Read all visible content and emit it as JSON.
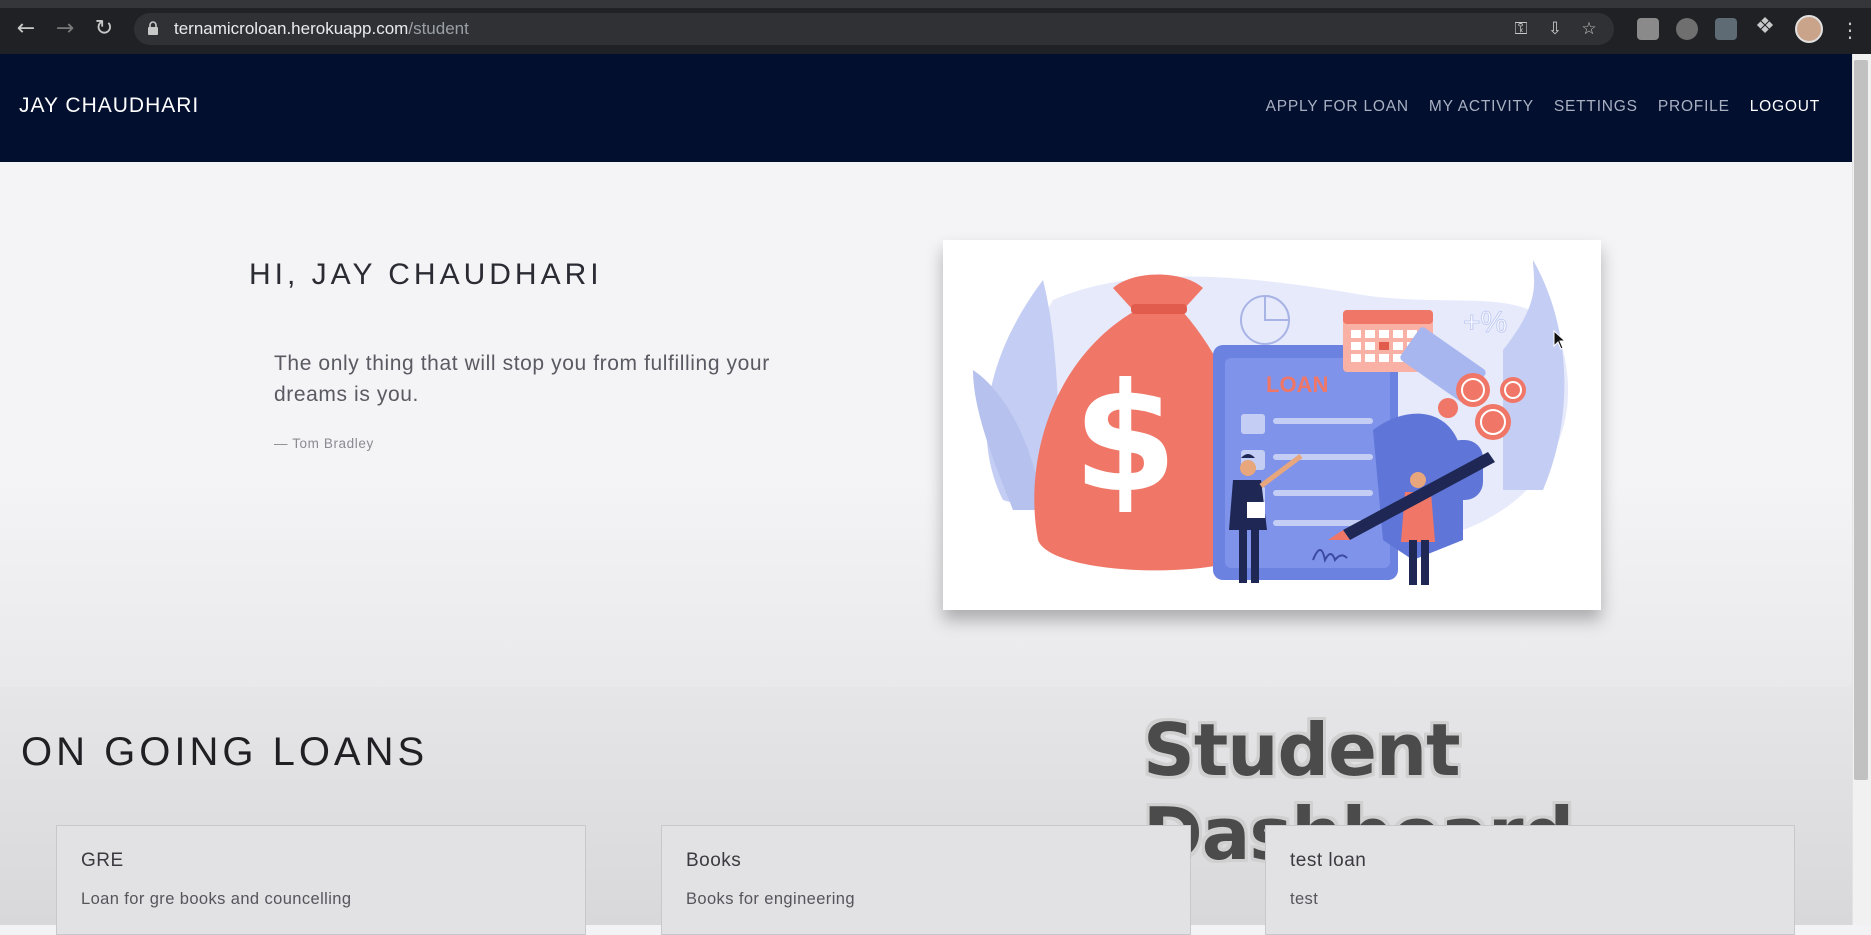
{
  "browser": {
    "url_host": "ternamicroloan.herokuapp.com",
    "url_path": "/student"
  },
  "navbar": {
    "brand": "JAY CHAUDHARI",
    "links": [
      "APPLY FOR LOAN",
      "MY ACTIVITY",
      "SETTINGS",
      "PROFILE",
      "LOGOUT"
    ]
  },
  "hero": {
    "greeting": "HI, JAY CHAUDHARI",
    "quote": "The only thing that will stop you from fulfilling your dreams is you.",
    "author": "— Tom Bradley",
    "illustration_label": "LOAN",
    "illustration_percent": "+%"
  },
  "loans": {
    "title": "ON GOING LOANS",
    "items": [
      {
        "title": "GRE",
        "description": "Loan for gre books and councelling"
      },
      {
        "title": "Books",
        "description": "Books for engineering"
      },
      {
        "title": "test loan",
        "description": "test"
      }
    ]
  },
  "video_overlay": "Student Dashboard",
  "colors": {
    "navbar_bg": "#020f2f",
    "money_bag": "#f07767",
    "loan_doc": "#6b82e0",
    "leaf": "#c4cdf3"
  }
}
